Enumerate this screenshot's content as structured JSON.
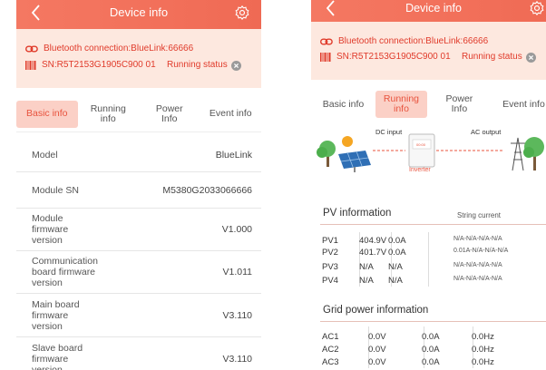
{
  "left": {
    "header": {
      "title": "Device info"
    },
    "banner": {
      "bluetooth": "Bluetooth connection:BlueLink:66666",
      "sn": "SN:R5T2153G1905C900 01",
      "running_status": "Running status"
    },
    "tabs": [
      {
        "label": "Basic info",
        "active": true
      },
      {
        "label": "Running info",
        "active": false
      },
      {
        "label": "Power Info",
        "active": false
      },
      {
        "label": "Event info",
        "active": false
      }
    ],
    "rows": [
      {
        "label": "Model",
        "value": "BlueLink"
      },
      {
        "label": "Module SN",
        "value": "M5380G2033066666"
      },
      {
        "label": "Module firmware version",
        "value": "V1.000"
      },
      {
        "label": "Communication board firmware version",
        "value": "V1.011"
      },
      {
        "label": "Main board firmware version",
        "value": "V3.110"
      },
      {
        "label": "Slave board firmware version",
        "value": "V3.110"
      }
    ]
  },
  "right": {
    "header": {
      "title": "Device info"
    },
    "banner": {
      "bluetooth": "Bluetooth connection:BlueLink:66666",
      "sn": "SN:R5T2153G1905C900 01",
      "running_status": "Running status"
    },
    "tabs": [
      {
        "label": "Basic info",
        "active": false
      },
      {
        "label": "Running info",
        "active": true
      },
      {
        "label": "Power Info",
        "active": false
      },
      {
        "label": "Event info",
        "active": false
      }
    ],
    "flow": {
      "dc_label": "DC input",
      "ac_label": "AC output",
      "inverter_label": "Inverter"
    },
    "pv": {
      "title": "PV information",
      "string_current_label": "String current",
      "rows": [
        {
          "name": "PV1",
          "voltage": "404.9V",
          "current": "0.0A",
          "string": "N/A-N/A-N/A-N/A"
        },
        {
          "name": "PV2",
          "voltage": "401.7V",
          "current": "0.0A",
          "string": "0.01A-N/A-N/A-N/A"
        },
        {
          "name": "PV3",
          "voltage": "N/A",
          "current": "N/A",
          "string": "N/A-N/A-N/A-N/A"
        },
        {
          "name": "PV4",
          "voltage": "N/A",
          "current": "N/A",
          "string": "N/A-N/A-N/A-N/A"
        }
      ]
    },
    "grid": {
      "title": "Grid power information",
      "rows": [
        {
          "name": "AC1",
          "voltage": "0.0V",
          "current": "0.0A",
          "freq": "0.0Hz"
        },
        {
          "name": "AC2",
          "voltage": "0.0V",
          "current": "0.0A",
          "freq": "0.0Hz"
        },
        {
          "name": "AC3",
          "voltage": "0.0V",
          "current": "0.0A",
          "freq": "0.0Hz"
        }
      ]
    }
  },
  "colors": {
    "accent": "#f2705a",
    "banner_bg": "#fde8df",
    "alert_text": "#e03a2a",
    "active_tab_bg": "#fbd0c6"
  }
}
